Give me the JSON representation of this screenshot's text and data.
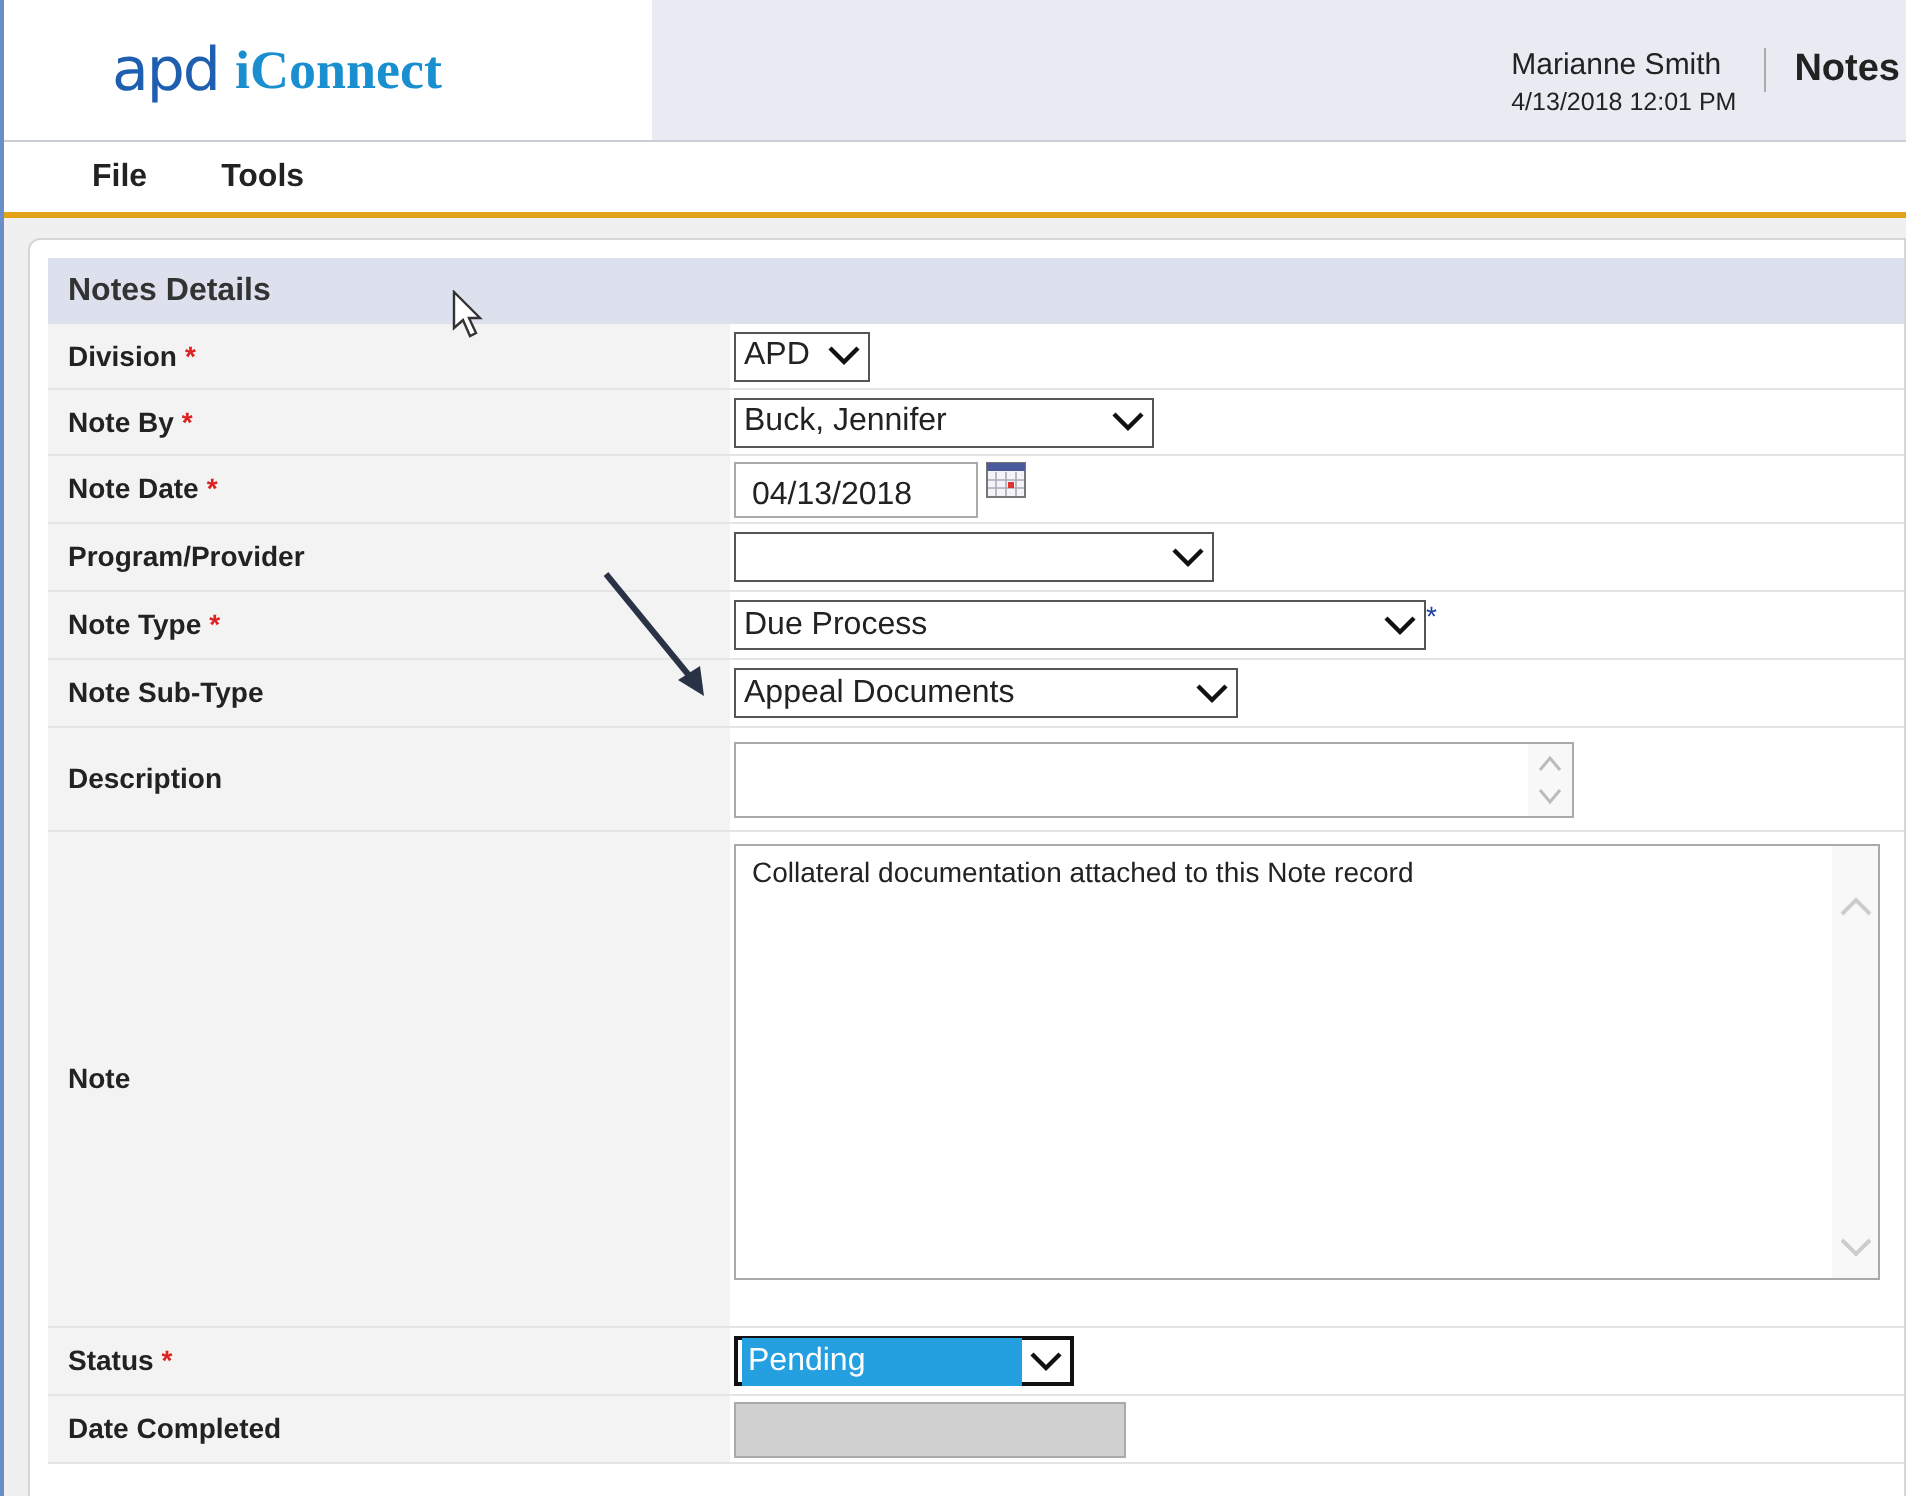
{
  "header": {
    "logo": [
      "apd",
      "iConnect"
    ],
    "user": "Marianne Smith",
    "datetime": "4/13/2018 12:01 PM",
    "page_title": "Notes"
  },
  "menu": [
    "File",
    "Tools"
  ],
  "panel": {
    "title": "Notes Details"
  },
  "fields": [
    {
      "label": "Division",
      "required": true,
      "kind": "select",
      "value": "APD"
    },
    {
      "label": "Note By",
      "required": true,
      "kind": "select",
      "value": "Buck, Jennifer"
    },
    {
      "label": "Note Date",
      "required": true,
      "kind": "date",
      "value": "04/13/2018"
    },
    {
      "label": "Program/Provider",
      "required": false,
      "kind": "select"
    },
    {
      "label": "Note Type",
      "required": true,
      "kind": "select",
      "value": "Due Process",
      "suffix": "*"
    },
    {
      "label": "Note Sub-Type",
      "required": false,
      "kind": "select",
      "value": "Appeal Documents"
    },
    {
      "label": "Description",
      "required": false,
      "kind": "textbox"
    },
    {
      "label": "Note",
      "required": false,
      "kind": "textarea",
      "value": "Collateral documentation attached to this Note record"
    },
    {
      "label": "Status",
      "required": true,
      "kind": "select",
      "value": "Pending",
      "focused": true
    },
    {
      "label": "Date Completed",
      "required": false,
      "kind": "text",
      "disabled": true
    }
  ]
}
